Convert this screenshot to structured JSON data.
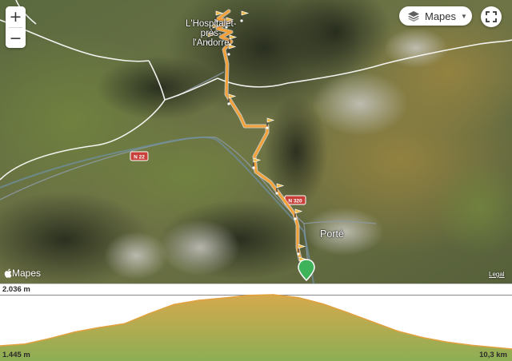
{
  "map": {
    "place_labels": {
      "town_top": [
        "L'Hospitalet-",
        "près-",
        "l'Andorre"
      ],
      "porte": "Porté"
    },
    "road_labels": [
      "N 22",
      "N 320"
    ],
    "attribution": "Mapes",
    "legal": "Legal",
    "colors": {
      "route": "#f5a13a",
      "route_outline": "#ffffff",
      "marker": "#3fb35a",
      "border": "#ffffff",
      "road_shield": "#c8403a"
    }
  },
  "controls": {
    "zoom_in": "+",
    "zoom_out": "−",
    "map_type": "Mapes",
    "layers_icon": "layers-icon",
    "fullscreen_icon": "fullscreen-icon"
  },
  "elevation_profile": {
    "max_label": "2.036 m",
    "min_label": "1.445 m",
    "distance_label": "10,3 km",
    "colors": {
      "fill_top": "#d5a94d",
      "fill_bottom": "#8dae54",
      "line": "#e2a13e"
    },
    "chart_data": {
      "type": "area",
      "title": "",
      "xlabel": "",
      "ylabel": "",
      "x": [
        0,
        0.5,
        1.0,
        1.5,
        2.0,
        2.5,
        3.0,
        3.5,
        4.0,
        4.5,
        5.0,
        5.5,
        6.0,
        6.5,
        7.0,
        7.5,
        8.0,
        8.5,
        9.0,
        9.5,
        10.3
      ],
      "y": [
        1480,
        1500,
        1560,
        1630,
        1680,
        1720,
        1830,
        1930,
        1975,
        2000,
        2030,
        2036,
        2005,
        1935,
        1840,
        1740,
        1640,
        1570,
        1520,
        1485,
        1445
      ],
      "xlim": [
        0,
        10.3
      ],
      "ylim": [
        1445,
        2036
      ]
    }
  }
}
